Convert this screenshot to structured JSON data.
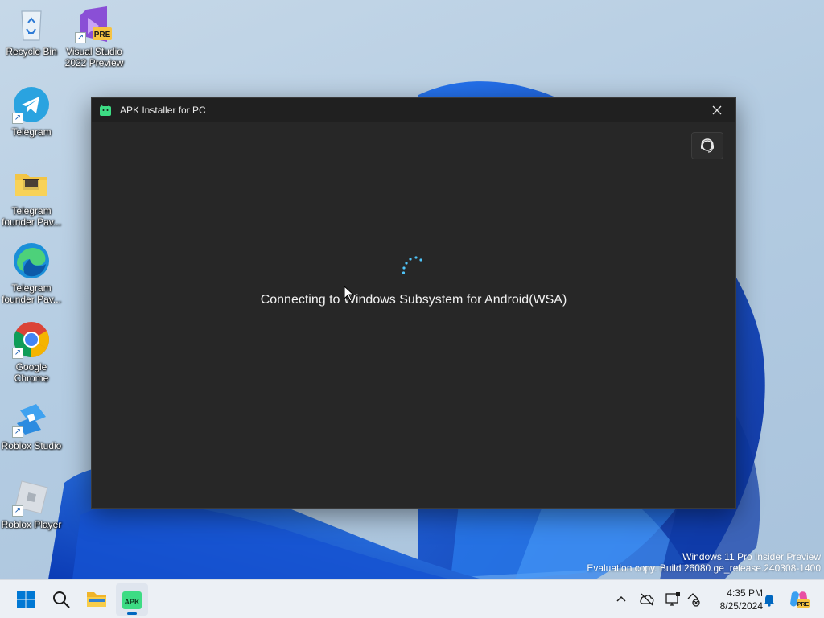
{
  "desktop": {
    "icons": [
      {
        "label": "Recycle Bin",
        "name": "recycle-bin"
      },
      {
        "label": "Visual Studio 2022 Preview",
        "name": "visual-studio",
        "badge": "PRE"
      },
      {
        "label": "Telegram",
        "name": "telegram"
      },
      {
        "label": "Telegram founder Pav...",
        "name": "telegram-folder"
      },
      {
        "label": "Telegram founder Pav...",
        "name": "edge-link"
      },
      {
        "label": "Google Chrome",
        "name": "google-chrome"
      },
      {
        "label": "Roblox Studio",
        "name": "roblox-studio"
      },
      {
        "label": "Roblox Player",
        "name": "roblox-player"
      }
    ],
    "shortcut_glyph": "↗"
  },
  "window": {
    "title": "APK Installer for PC",
    "close_glyph": "✕",
    "status": "Connecting to Windows Subsystem for Android(WSA)",
    "help_icon": "support-icon"
  },
  "watermark": {
    "line1": "Windows 11 Pro Insider Preview",
    "line2": "Evaluation copy. Build 26080.ge_release.240308-1400"
  },
  "taskbar": {
    "apps": [
      "start",
      "search",
      "file-explorer",
      "apk-installer"
    ],
    "apk_label": "APK",
    "tray": {
      "chevron": "^",
      "time": "4:35 PM",
      "date": "8/25/2024",
      "copilot_badge": "PRE"
    }
  },
  "colors": {
    "accent": "#0067c0",
    "window_bg": "#272727",
    "titlebar_bg": "#202020",
    "spinner": "#4fc3f7"
  }
}
